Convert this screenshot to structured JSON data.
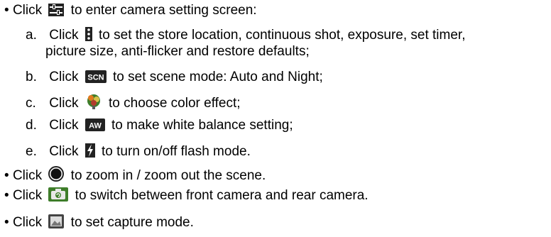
{
  "items": [
    {
      "marker": "•",
      "pre": "Click",
      "icon": "camera-settings-icon",
      "post": "to enter camera setting screen:"
    },
    {
      "marker": "a.",
      "pre": "Click",
      "icon": "more-options-icon",
      "post": "to set the store location, continuous shot, exposure, set timer,",
      "continuation": "picture size, anti-flicker and restore defaults;"
    },
    {
      "marker": "b.",
      "pre": "Click",
      "icon": "scene-mode-icon",
      "icon_text": "SCN",
      "post": "to set scene mode: Auto and Night;"
    },
    {
      "marker": "c.",
      "pre": "Click",
      "icon": "color-effect-icon",
      "post": "to choose color effect;"
    },
    {
      "marker": "d.",
      "pre": "Click",
      "icon": "white-balance-icon",
      "icon_text": "AW",
      "post": "to make white balance setting;"
    },
    {
      "marker": "e.",
      "pre": "Click",
      "icon": "flash-icon",
      "post": "to turn on/off flash mode."
    },
    {
      "marker": "•",
      "pre": "Click",
      "icon": "zoom-icon",
      "post": "to zoom in / zoom out the scene."
    },
    {
      "marker": "•",
      "pre": "Click",
      "icon": "switch-camera-icon",
      "post": "to switch between front camera and rear camera."
    },
    {
      "marker": "•",
      "pre": "Click",
      "icon": "capture-mode-icon",
      "post": "to set capture mode."
    }
  ],
  "colors": {
    "text": "#000000",
    "icon_dark": "#1a1a1a",
    "icon_mid": "#5a5a5a",
    "icon_green": "#3e7d2a",
    "icon_orange": "#e07a1f"
  }
}
